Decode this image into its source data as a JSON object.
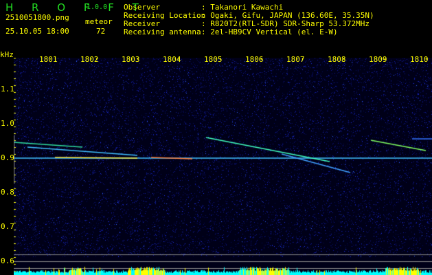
{
  "app": {
    "title": "H R O F F T",
    "version": "1.0.0"
  },
  "file": {
    "name": "2510051800.png",
    "datetime": "25.10.05 18:00"
  },
  "meteor": {
    "label": "meteor",
    "count": "72"
  },
  "info": [
    {
      "label": "Observer",
      "value": ": Takanori Kawachi"
    },
    {
      "label": "Receiving Location",
      "value": ": Ogaki, Gifu, JAPAN (136.60E, 35.35N)"
    },
    {
      "label": "Receiver",
      "value": ": R820T2(RTL-SDR) SDR-Sharp 53.372MHz"
    },
    {
      "label": "Receiving antenna",
      "value": ": 2el-HB9CV Vertical (el. E-W)"
    }
  ],
  "spectrogram": {
    "y_unit": "kHz",
    "x_ticks": [
      "1801",
      "1802",
      "1803",
      "1804",
      "1805",
      "1806",
      "1807",
      "1808",
      "1809",
      "1810"
    ],
    "y_ticks": [
      "1.1",
      "1.0",
      "0.9",
      "0.8",
      "0.7",
      "0.6"
    ],
    "colors": {
      "text": "#ffff00",
      "logo": "#22dd22",
      "noise": "#1a22cc",
      "bar_low": "#00ffff",
      "bar_high": "#ffff00"
    }
  }
}
